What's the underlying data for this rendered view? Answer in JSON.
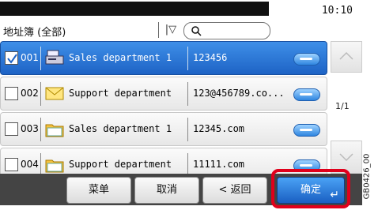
{
  "status": {
    "time": "10:10"
  },
  "header": {
    "title": "地址簿 (全部)"
  },
  "rows": [
    {
      "num": "001",
      "name": "Sales department 1",
      "addr": "123456",
      "type": "fax",
      "selected": true
    },
    {
      "num": "002",
      "name": "Support department",
      "addr": "123@456789.co...",
      "type": "email",
      "selected": false
    },
    {
      "num": "003",
      "name": "Sales department 1",
      "addr": "12345.com",
      "type": "folder",
      "selected": false
    },
    {
      "num": "004",
      "name": "Support department",
      "addr": "11111.com",
      "type": "folder",
      "selected": false
    }
  ],
  "pager": {
    "page": "1/1"
  },
  "bottom": {
    "menu": "菜单",
    "cancel": "取消",
    "back": "< 返回",
    "ok": "确定"
  },
  "figure_code": "GB0426_00",
  "colors": {
    "accent": "#1e63c5",
    "highlight": "#e0001b"
  }
}
